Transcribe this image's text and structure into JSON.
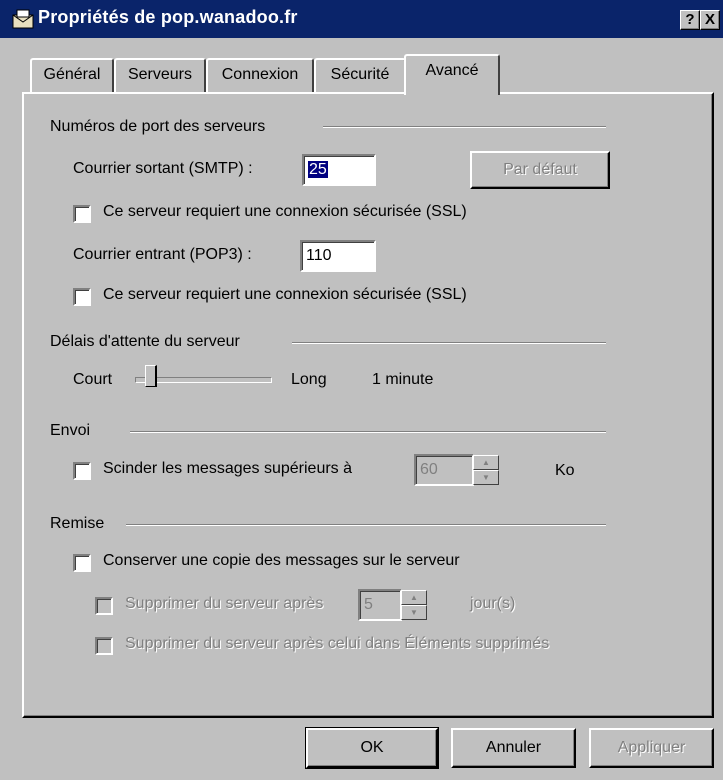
{
  "window": {
    "title": "Propriétés de pop.wanadoo.fr",
    "help_glyph": "?",
    "close_glyph": "X"
  },
  "tabs": [
    {
      "label": "Général"
    },
    {
      "label": "Serveurs"
    },
    {
      "label": "Connexion"
    },
    {
      "label": "Sécurité"
    },
    {
      "label": "Avancé",
      "active": true
    }
  ],
  "ports": {
    "group_label": "Numéros de port des serveurs",
    "smtp_label": "Courrier sortant (SMTP) :",
    "smtp_value": "25",
    "default_button": "Par défaut",
    "smtp_ssl_label": "Ce serveur requiert une connexion sécurisée (SSL)",
    "smtp_ssl_checked": false,
    "pop3_label": "Courrier entrant (POP3) :",
    "pop3_value": "110",
    "pop3_ssl_label": "Ce serveur requiert une connexion sécurisée (SSL)",
    "pop3_ssl_checked": false
  },
  "timeout": {
    "group_label": "Délais d'attente du serveur",
    "short_label": "Court",
    "long_label": "Long",
    "value_text": "1 minute",
    "slider_level": 0.1
  },
  "sending": {
    "group_label": "Envoi",
    "split_label": "Scinder les messages supérieurs à",
    "split_checked": false,
    "split_value": "60",
    "unit": "Ko"
  },
  "delivery": {
    "group_label": "Remise",
    "keep_copy_label": "Conserver une copie des messages sur le serveur",
    "keep_copy_checked": false,
    "delete_after_label": "Supprimer du serveur après",
    "delete_after_value": "5",
    "delete_after_unit": "jour(s)",
    "delete_deleted_label": "Supprimer du serveur après celui dans Éléments supprimés"
  },
  "buttons": {
    "ok": "OK",
    "cancel": "Annuler",
    "apply": "Appliquer"
  },
  "colors": {
    "titlebar": "#0a246a",
    "face": "#c0c0c0",
    "selection": "#000080"
  }
}
